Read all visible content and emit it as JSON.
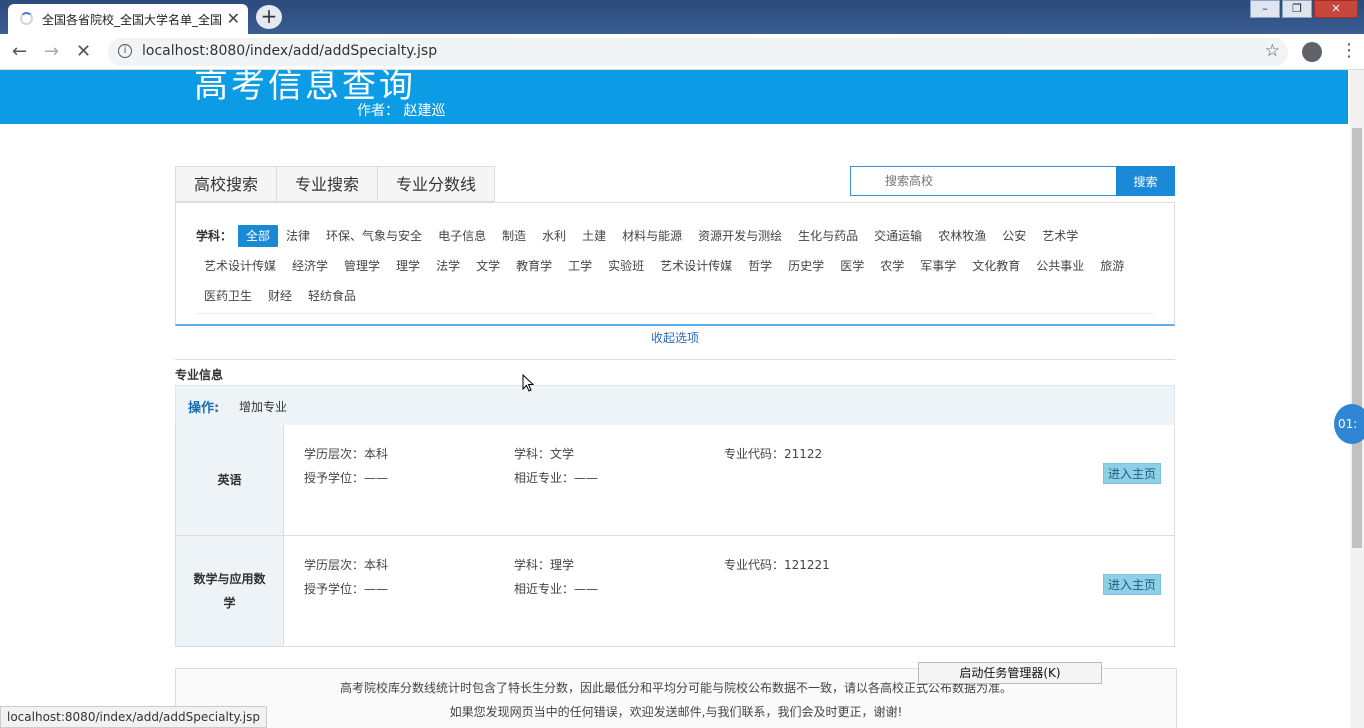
{
  "browser": {
    "tab_title": "全国各省院校_全国大学名单_全国",
    "tab_close": "✕",
    "new_tab": "+",
    "url": "localhost:8080/index/add/addSpecialty.jsp",
    "status_url": "localhost:8080/index/add/addSpecialty.jsp"
  },
  "banner": {
    "title": "高考信息查询",
    "author": "作者： 赵建巡"
  },
  "search_tabs": [
    "高校搜索",
    "专业搜索",
    "专业分数线"
  ],
  "search": {
    "placeholder": "搜索高校",
    "button": "搜索"
  },
  "filter": {
    "label": "学科：",
    "options": [
      "全部",
      "法律",
      "环保、气象与安全",
      "电子信息",
      "制造",
      "水利",
      "土建",
      "材料与能源",
      "资源开发与测绘",
      "生化与药品",
      "交通运输",
      "农林牧渔",
      "公安",
      "艺术学",
      "艺术设计传媒",
      "经济学",
      "管理学",
      "理学",
      "法学",
      "文学",
      "教育学",
      "工学",
      "实验班",
      "艺术设计传媒",
      "哲学",
      "历史学",
      "医学",
      "农学",
      "军事学",
      "文化教育",
      "公共事业",
      "旅游",
      "医药卫生",
      "财经",
      "轻纺食品"
    ],
    "collapse_label": "收起选项"
  },
  "section_title": "专业信息",
  "operations": {
    "label": "操作:",
    "add_link": "增加专业"
  },
  "specialties": [
    {
      "name": "英语",
      "level": "学历层次：本科",
      "discipline": "学科：文学",
      "code": "专业代码：21122",
      "degree": "授予学位：——",
      "related": "相近专业：——",
      "enter": "进入主页"
    },
    {
      "name": "数学与应用数学",
      "level": "学历层次：本科",
      "discipline": "学科：理学",
      "code": "专业代码：121221",
      "degree": "授予学位：——",
      "related": "相近专业：——",
      "enter": "进入主页"
    }
  ],
  "footer": {
    "line1": "高考院校库分数线统计时包含了特长生分数，因此最低分和平均分可能与院校公布数据不一致，请以各高校正式公布数据为准。",
    "line2": "如果您发现网页当中的任何错误，欢迎发送邮件,与我们联系，我们会及时更正，谢谢!"
  },
  "popup": {
    "task_manager": "启动任务管理器(K)"
  },
  "float_clock": "01:",
  "colors": {
    "banner": "#0c9ce6",
    "accent": "#1a8ad6",
    "enter_button": "#8fd0e6"
  }
}
